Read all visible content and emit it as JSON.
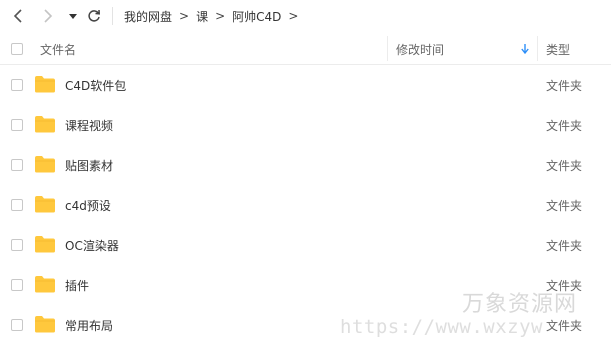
{
  "breadcrumb": [
    "我的网盘",
    "课",
    "阿帅C4D"
  ],
  "breadcrumb_separator": ">",
  "header": {
    "name_label": "文件名",
    "mtime_label": "修改时间",
    "type_label": "类型"
  },
  "files": [
    {
      "name": "C4D软件包",
      "type": "文件夹"
    },
    {
      "name": "课程视频",
      "type": "文件夹"
    },
    {
      "name": "贴图素材",
      "type": "文件夹"
    },
    {
      "name": "c4d预设",
      "type": "文件夹"
    },
    {
      "name": "OC渲染器",
      "type": "文件夹"
    },
    {
      "name": "插件",
      "type": "文件夹"
    },
    {
      "name": "常用布局",
      "type": "文件夹"
    }
  ],
  "watermark": {
    "text": "万象资源网",
    "url": "https://www.wxzyw"
  },
  "colors": {
    "folder": "#ffc83d",
    "sort_arrow": "#2c8ef8",
    "border": "#ececec"
  },
  "icons": {
    "back": "back-arrow-icon",
    "forward": "forward-arrow-icon",
    "history": "dropdown-icon",
    "refresh": "refresh-icon",
    "sort": "sort-descending-icon",
    "folder": "folder-icon"
  }
}
